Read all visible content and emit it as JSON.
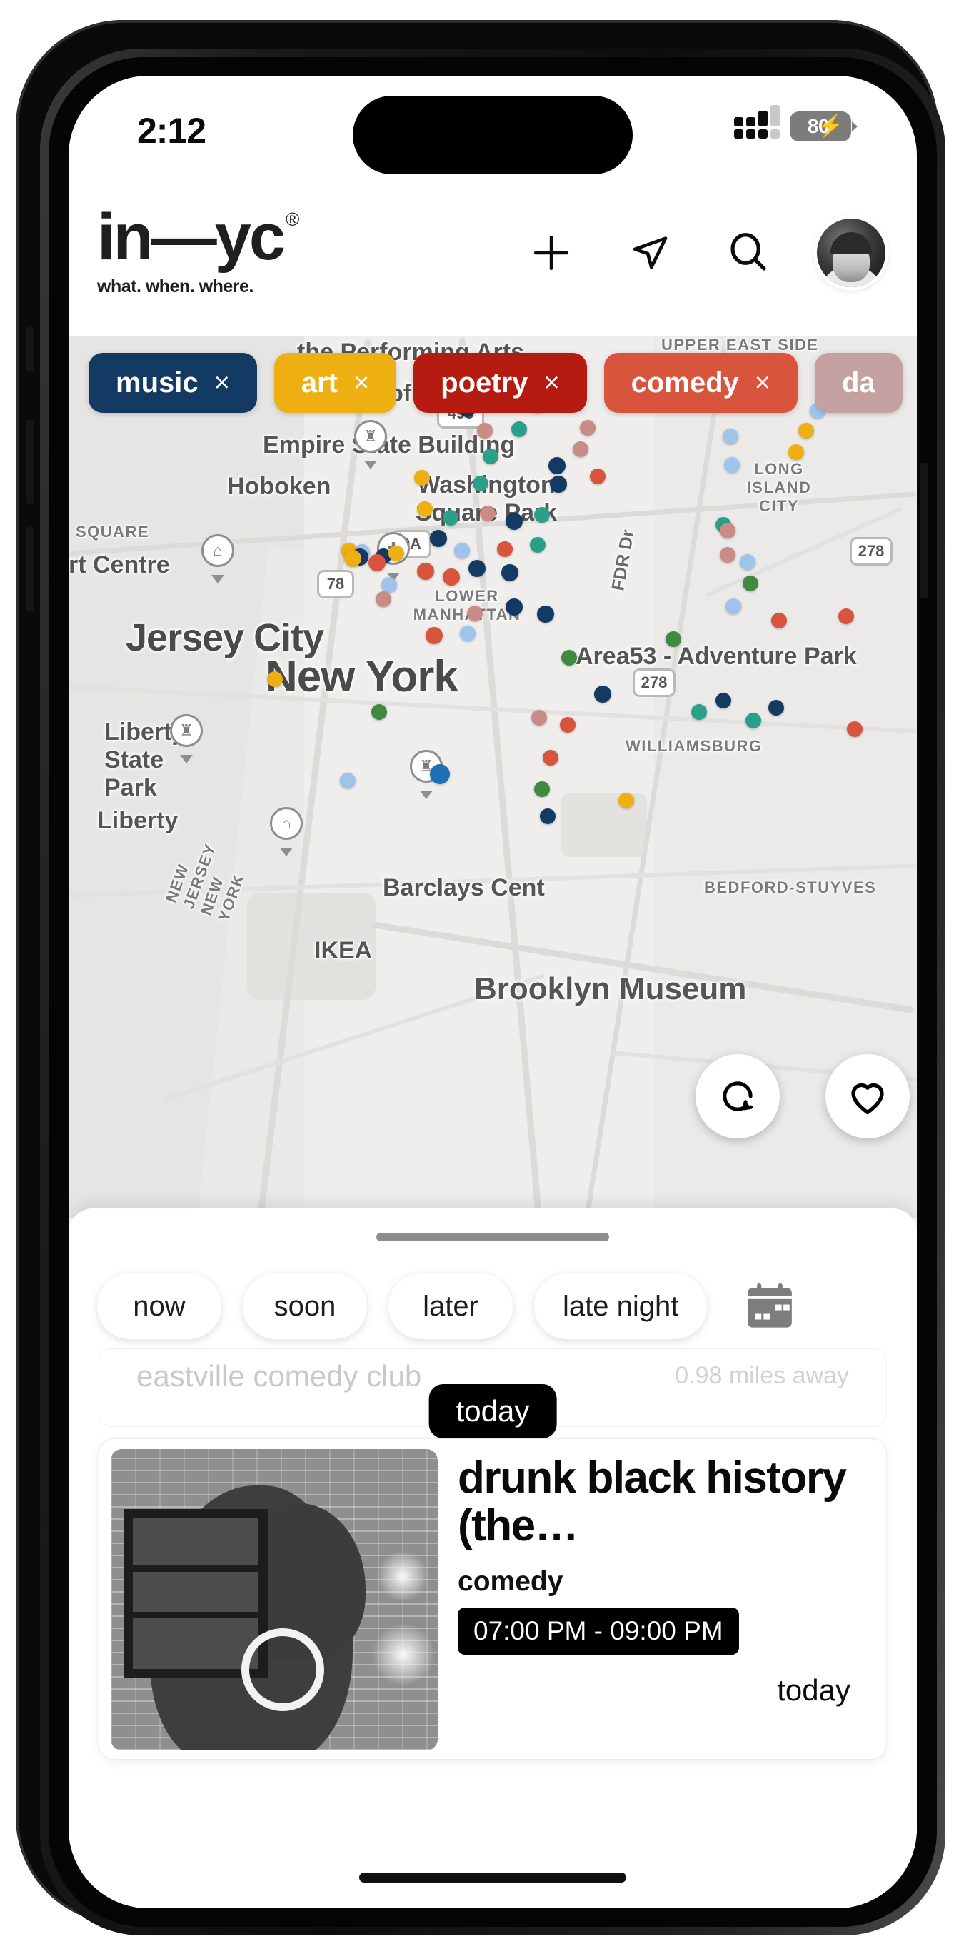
{
  "status_bar": {
    "time": "2:12",
    "battery_level": "80",
    "battery_charging_icon": "bolt-icon",
    "signal_icon": "cellular-signal-icon"
  },
  "header": {
    "brand": "in—yc",
    "brand_mark": "®",
    "tagline": "what. when. where.",
    "actions": [
      {
        "name": "add-button",
        "icon": "plus-icon"
      },
      {
        "name": "locate-button",
        "icon": "navigation-arrow-icon"
      },
      {
        "name": "search-button",
        "icon": "search-icon"
      },
      {
        "name": "profile-avatar",
        "icon": "avatar-icon"
      }
    ]
  },
  "map": {
    "category_chips": [
      {
        "label": "music",
        "color": "#123a63",
        "remove": "×"
      },
      {
        "label": "art",
        "color": "#edaf12",
        "remove": "×"
      },
      {
        "label": "poetry",
        "color": "#b51b10",
        "remove": "×"
      },
      {
        "label": "comedy",
        "color": "#d9543c",
        "remove": "×"
      },
      {
        "label": "da",
        "color": "#c5a0a0",
        "remove": ""
      }
    ],
    "labels": [
      "the Performing Arts",
      "UPPER EAST SIDE",
      "of Modern Art",
      "Empire State Building",
      "Hoboken",
      "Washington Square Park",
      "LONG ISLAND CITY",
      "SQUARE",
      "rt Centre",
      "Jersey City",
      "LOWER MANHATTAN",
      "New York",
      "FDR Dr",
      "Area53 - Adventure Park",
      "Liberty State Park",
      "Liberty",
      "WILLIAMSBURG",
      "NEW JERSEY NEW YORK",
      "Barclays Cent",
      "BEDFORD-STUYVES",
      "IKEA",
      "Brooklyn Museum",
      "495",
      "9A",
      "78",
      "278",
      "278"
    ],
    "controls": [
      {
        "name": "map-refresh-button",
        "icon": "refresh-icon"
      },
      {
        "name": "map-favorites-button",
        "icon": "heart-icon"
      }
    ]
  },
  "sheet": {
    "time_filters": [
      "now",
      "soon",
      "later",
      "late night"
    ],
    "calendar_icon": "calendar-icon",
    "peek_card": {
      "venue": "eastville comedy club",
      "distance": "0.98 miles away"
    },
    "day_badge": "today",
    "event": {
      "title": "drunk black history (the…",
      "category": "comedy",
      "time_range": "07:00 PM - 09:00 PM",
      "when": "today",
      "image_alt": "brick-wall-mural-silhouette"
    }
  }
}
